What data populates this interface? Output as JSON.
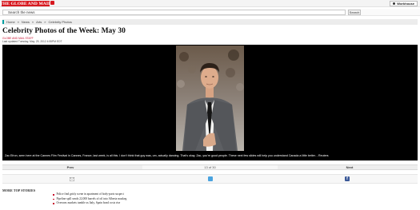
{
  "header": {
    "logo_text": "THE GLOBE AND MAIL",
    "account_label": "Workhouse"
  },
  "search": {
    "placeholder": "Search the news",
    "button_label": "Search"
  },
  "breadcrumb": [
    "Home",
    "News",
    "Arts",
    "Celebrity Photos"
  ],
  "article": {
    "title": "Celebrity Photos of the Week: May 30",
    "byline": "GLOBE AND MAIL STAFF",
    "updated": "Last updated Tuesday, May. 29, 2012 4:55PM EDT"
  },
  "gallery": {
    "caption": "Zac Efron, seen here at the Cannes Film Festival in Cannes, France, last week, is all this. I don't think that guy was, um, actually dancing. That's okay, Zac, you're good people. These next few slides will help you understand Canada a little better. - Reuters",
    "prev_label": "Prev",
    "counter": "13 of 30",
    "next_label": "Next"
  },
  "share": {
    "icons": [
      "email-icon",
      "twitter-icon",
      "facebook-icon"
    ],
    "facebook_glyph": "f"
  },
  "more_stories": {
    "heading": "MORE TOP STORIES",
    "items": [
      "Police find grisly scene in apartment of body-parts suspect",
      "Pipeline spill sends 22,000 barrels of oil into Alberta muskeg",
      "Overseas markets tumble as Italy, Spain bond costs rise"
    ]
  },
  "colors": {
    "brand_red": "#d71920",
    "breadcrumb_teal": "#009ea0",
    "gallery_bg": "#000000",
    "twitter_blue": "#4aa3df",
    "facebook_blue": "#3b5998"
  }
}
